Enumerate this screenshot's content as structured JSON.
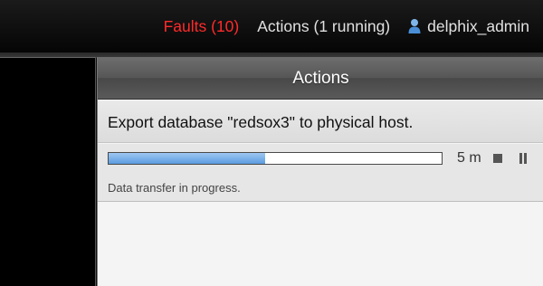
{
  "topnav": {
    "faults_label": "Faults (10)",
    "actions_label": "Actions (1 running)",
    "username": "delphix_admin",
    "user_icon": "user-icon",
    "faults_color": "#ff2a2a"
  },
  "panel": {
    "title": "Actions"
  },
  "action": {
    "title": "Export database \"redsox3\" to physical host.",
    "progress_fraction": 0.47,
    "time_remaining": "5 m",
    "status": "Data transfer in progress.",
    "progress_color": "#5b9ce0"
  }
}
